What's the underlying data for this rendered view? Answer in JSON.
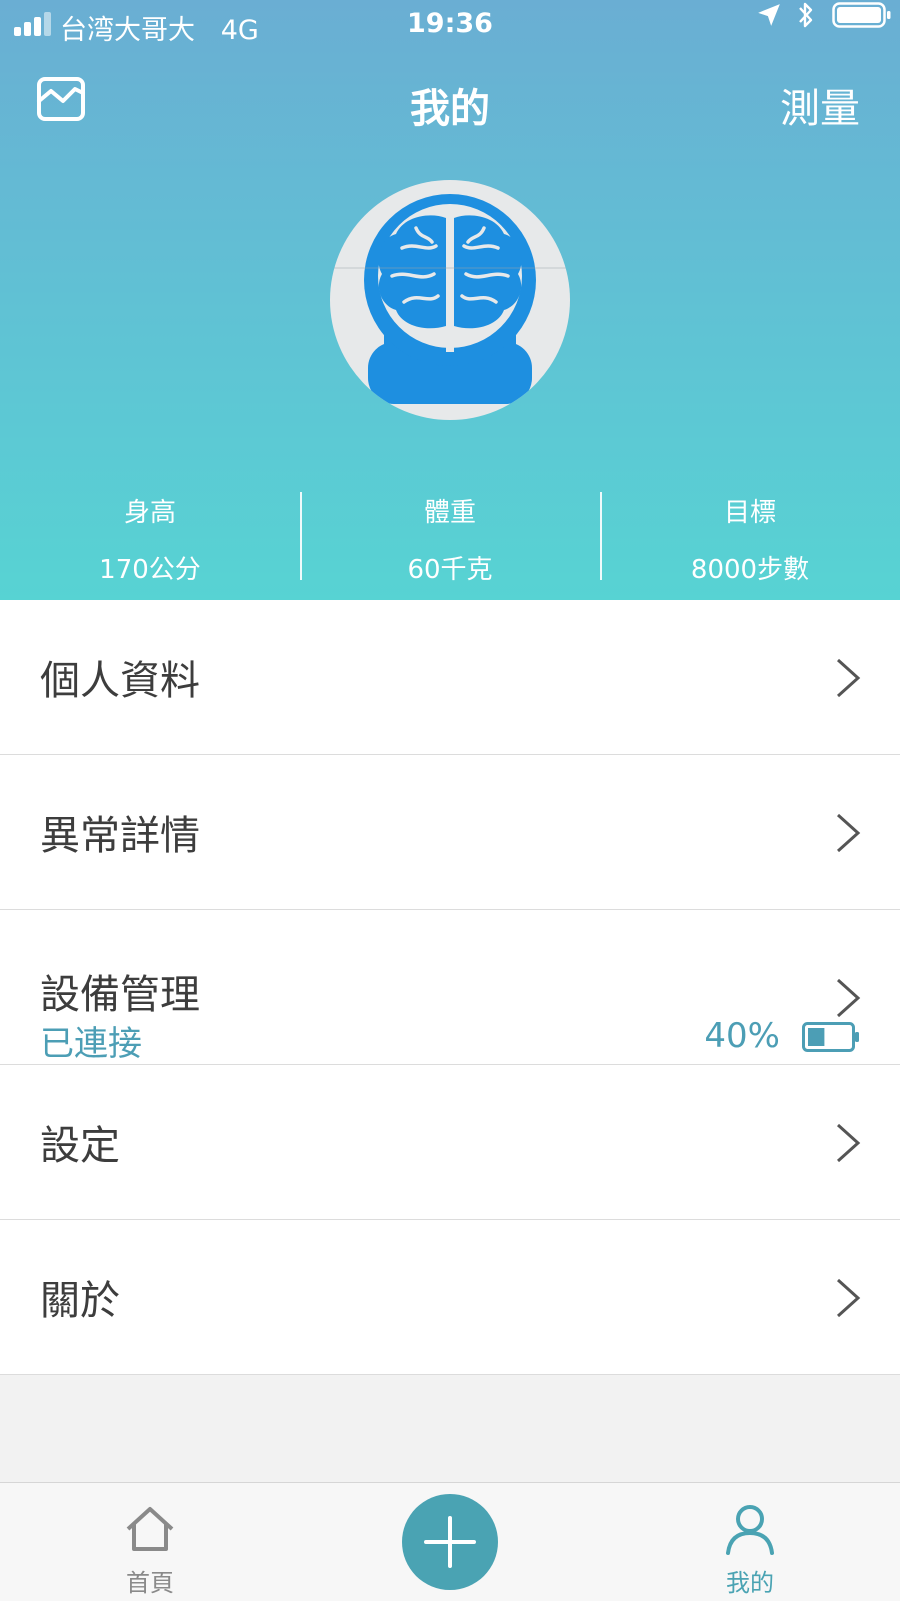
{
  "status_bar": {
    "carrier": "台湾大哥大",
    "network": "4G",
    "time": "19:36",
    "icons": [
      "signal-icon",
      "location-arrow-icon",
      "bluetooth-icon",
      "battery-icon"
    ]
  },
  "nav": {
    "title": "我的",
    "left_icon": "chart-icon",
    "right_label": "測量"
  },
  "profile": {
    "avatar_icon": "brain-icon",
    "stats": [
      {
        "label": "身高",
        "value": "170公分"
      },
      {
        "label": "體重",
        "value": "60千克"
      },
      {
        "label": "目標",
        "value": "8000步數"
      }
    ]
  },
  "menu": {
    "items": [
      {
        "label": "個人資料"
      },
      {
        "label": "異常詳情"
      },
      {
        "label": "設備管理",
        "sub_status": "已連接",
        "battery_percent": "40%",
        "battery_level": 0.4
      },
      {
        "label": "設定"
      },
      {
        "label": "關於"
      }
    ]
  },
  "tabbar": {
    "home_label": "首頁",
    "me_label": "我的",
    "add_icon": "plus-icon"
  },
  "colors": {
    "header_top": "#6aaed3",
    "header_bottom": "#57d3d3",
    "accent": "#4aa3b3",
    "brain_blue": "#1e8fe0",
    "text_dark": "#3d3d3d"
  }
}
